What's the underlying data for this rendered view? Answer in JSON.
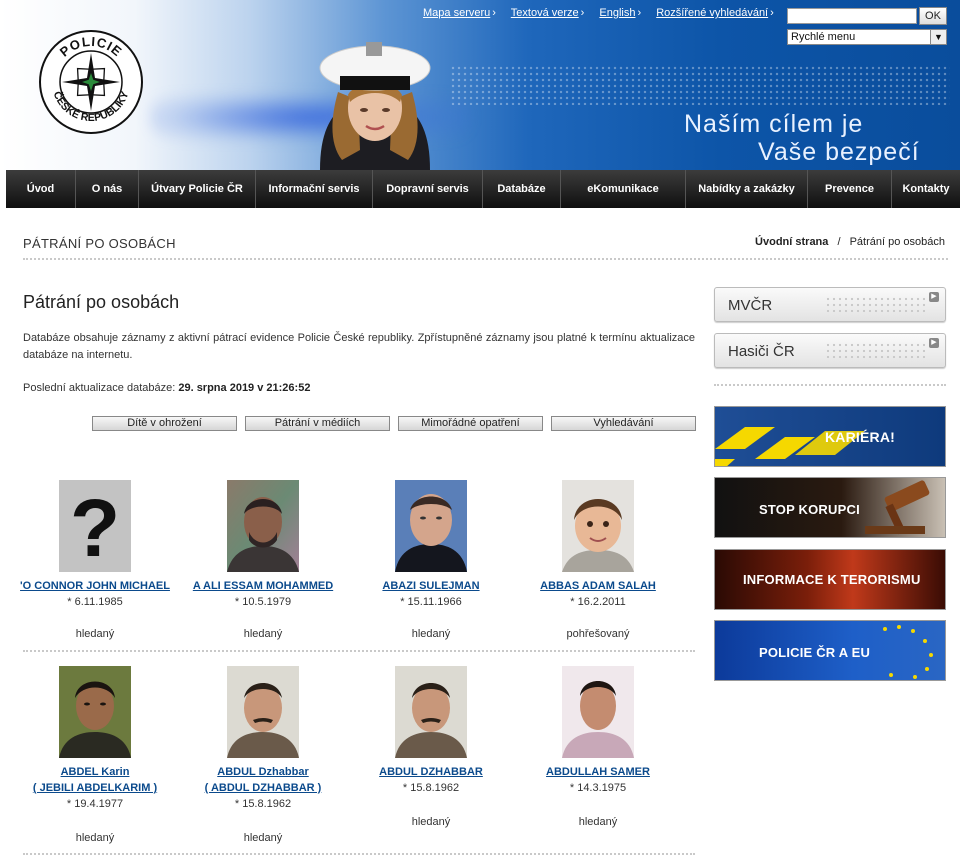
{
  "header": {
    "logo_text_top": "POLICIE",
    "logo_text_bottom": "ČESKÉ REPUBLIKY",
    "slogan_line1": "Naším cílem je",
    "slogan_line2": "Vaše bezpečí",
    "top_links": [
      "Mapa serveru",
      "Textová verze",
      "English",
      "Rozšířené vyhledávání"
    ],
    "search_placeholder": "",
    "search_button": "OK",
    "quick_menu": "Rychlé menu"
  },
  "nav": {
    "items": [
      {
        "label": "Úvod"
      },
      {
        "label": "O nás"
      },
      {
        "label": "Útvary Policie ČR"
      },
      {
        "label": "Informační servis"
      },
      {
        "label": "Dopravní servis"
      },
      {
        "label": "Databáze"
      },
      {
        "label": "eKomunikace"
      },
      {
        "label": "Nabídky a zakázky"
      },
      {
        "label": "Prevence"
      },
      {
        "label": "Kontakty"
      }
    ]
  },
  "page": {
    "heading": "PÁTRÁNÍ PO OSOBÁCH",
    "breadcrumb_home": "Úvodní strana",
    "breadcrumb_sep": "/",
    "breadcrumb_current": "Pátrání po osobách",
    "title": "Pátrání po osobách",
    "description": "Databáze obsahuje záznamy z aktivní pátrací evidence Policie České republiky. Zpřístupněné záznamy jsou platné k termínu aktualizace databáze na internetu.",
    "updated_label": "Poslední aktualizace databáze:",
    "updated_value": "29. srpna 2019 v 21:26:52",
    "filter_buttons": [
      "Dítě v ohrožení",
      "Pátrání v médiích",
      "Mimořádné opatření",
      "Vyhledávání"
    ]
  },
  "persons": [
    {
      "name": "'O CONNOR JOHN MICHAEL",
      "name2": "",
      "dob": "* 6.11.1985",
      "status": "hledaný"
    },
    {
      "name": "A ALI ESSAM MOHAMMED",
      "name2": "",
      "dob": "* 10.5.1979",
      "status": "hledaný"
    },
    {
      "name": "ABAZI SULEJMAN",
      "name2": "",
      "dob": "* 15.11.1966",
      "status": "hledaný"
    },
    {
      "name": "ABBAS ADAM SALAH",
      "name2": "",
      "dob": "* 16.2.2011",
      "status": "pohřešovaný"
    },
    {
      "name": "ABDEL Karin",
      "name2": "( JEBILI ABDELKARIM )",
      "dob": "* 19.4.1977",
      "status": "hledaný"
    },
    {
      "name": "ABDUL Dzhabbar",
      "name2": "( ABDUL DZHABBAR )",
      "dob": "* 15.8.1962",
      "status": "hledaný"
    },
    {
      "name": "ABDUL DZHABBAR",
      "name2": "",
      "dob": "* 15.8.1962",
      "status": "hledaný"
    },
    {
      "name": "ABDULLAH SAMER",
      "name2": "",
      "dob": "* 14.3.1975",
      "status": "hledaný"
    }
  ],
  "sidebar": {
    "mvcr": "MVČR",
    "hasici": "Hasiči ČR",
    "banners": [
      "KARIÉRA!",
      "STOP KORUPCI",
      "INFORMACE K TERORISMU",
      "POLICIE ČR A EU"
    ]
  },
  "colors": {
    "nav_bg": "#1a1a1a",
    "link": "#0b4a8c",
    "header_blue": "#0d55a8"
  }
}
